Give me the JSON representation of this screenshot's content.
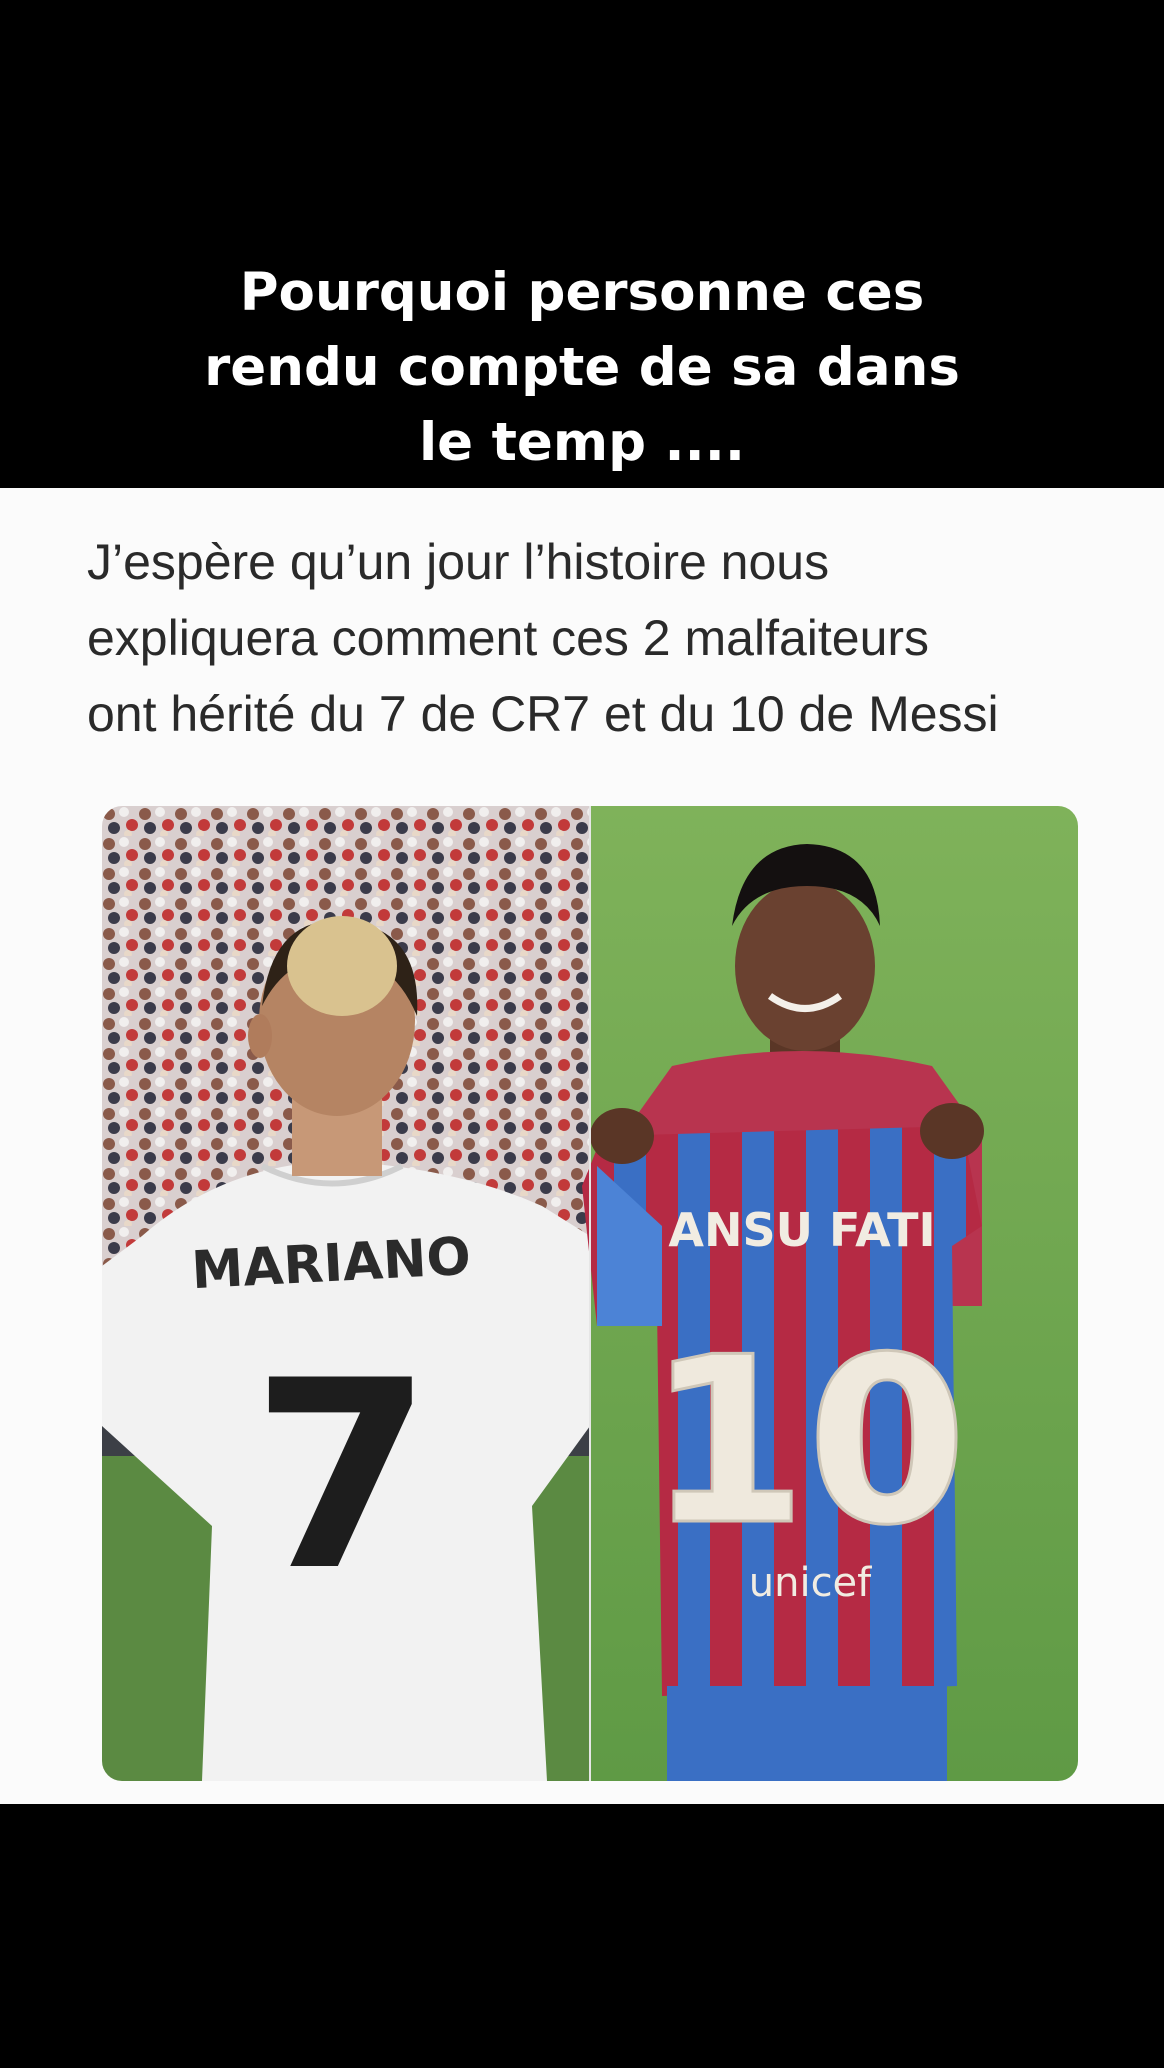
{
  "overlay_caption": {
    "lines": [
      "Pourquoi personne ces",
      "rendu compte de sa dans",
      "le temp ...."
    ]
  },
  "tweet": {
    "lines": [
      "J’espère qu’un jour l’histoire nous",
      "expliquera comment ces 2 malfaiteurs",
      "ont hérité du 7 de CR7 et du 10 de Messi"
    ]
  },
  "photo": {
    "left": {
      "jersey_name": "MARIANO",
      "jersey_number": "7"
    },
    "right": {
      "jersey_name": "ANSU FATI",
      "jersey_number": "10",
      "sponsor": "unicef"
    }
  },
  "colors": {
    "background": "#000000",
    "card": "#fbfbfb",
    "tweet_text": "#2a2a2a",
    "barca_blue": "#3a6fc4",
    "barca_red": "#b52a44",
    "pitch_green": "#6fa650"
  }
}
